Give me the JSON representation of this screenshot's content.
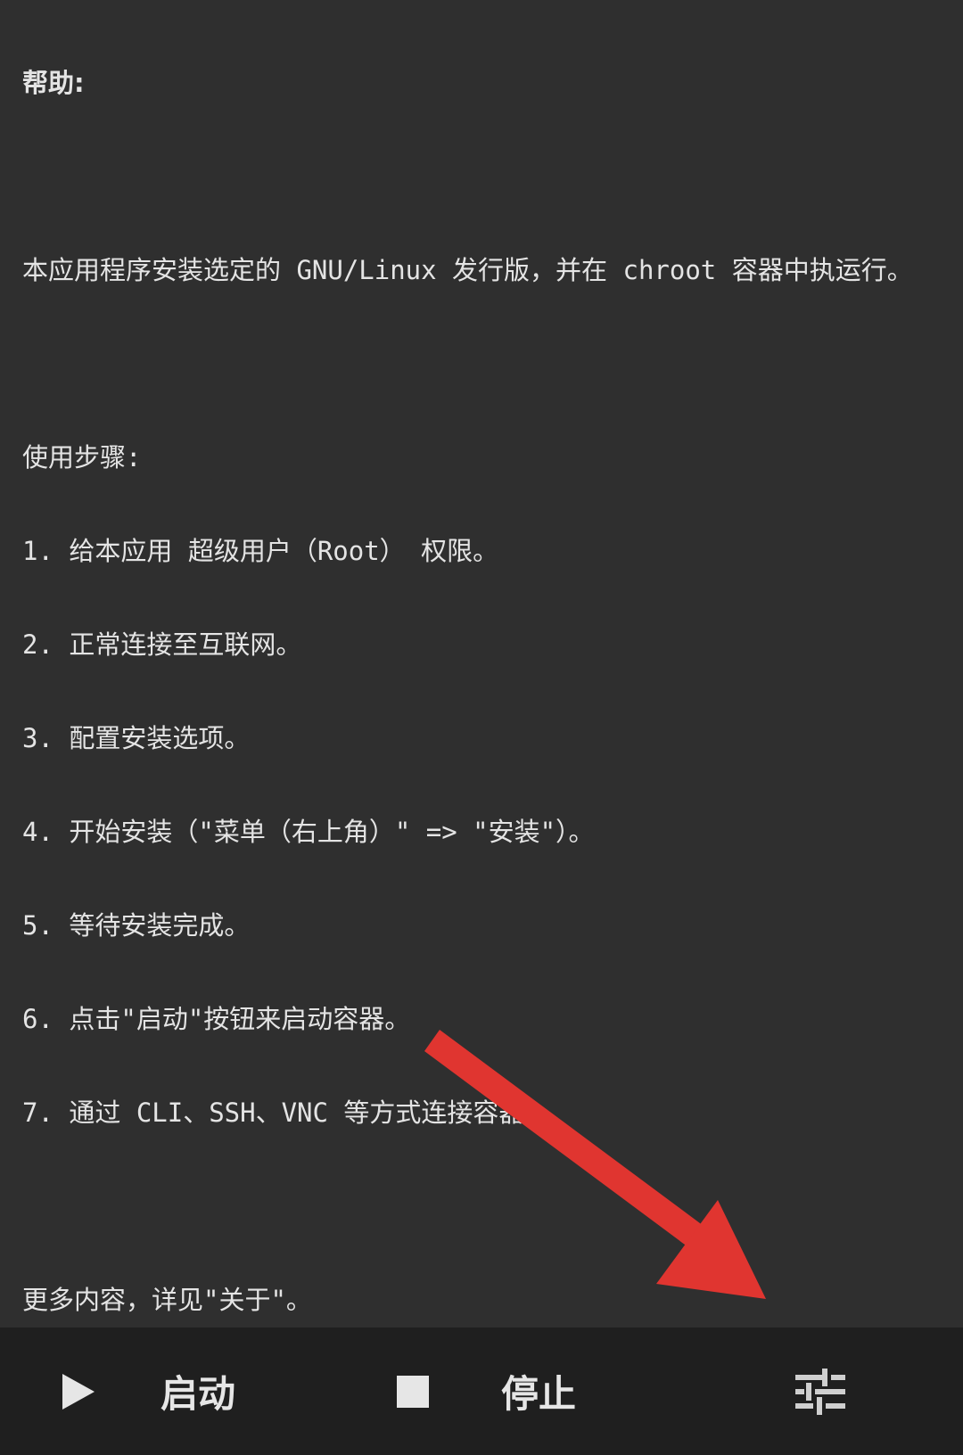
{
  "help": {
    "title": "帮助:",
    "intro": "本应用程序安装选定的 GNU/Linux 发行版，并在 chroot 容器中执运行。",
    "steps_heading": "使用步骤:",
    "steps": [
      "1. 给本应用 超级用户（Root） 权限。",
      "2. 正常连接至互联网。",
      "3. 配置安装选项。",
      "4. 开始安装（\"菜单（右上角）\" => \"安装\"）。",
      "5. 等待安装完成。",
      "6. 点击\"启动\"按钮来启动容器。",
      "7. 通过 CLI、SSH、VNC 等方式连接容器。"
    ],
    "more": "更多内容，详见\"关于\"。"
  },
  "toolbar": {
    "start_label": "启动",
    "stop_label": "停止",
    "start_icon": "play-icon",
    "stop_icon": "stop-icon",
    "settings_icon": "tune-icon"
  },
  "colors": {
    "background": "#2f2f2f",
    "toolbar": "#1f1f1f",
    "text": "#e4e4e4",
    "arrow": "#e03530"
  }
}
